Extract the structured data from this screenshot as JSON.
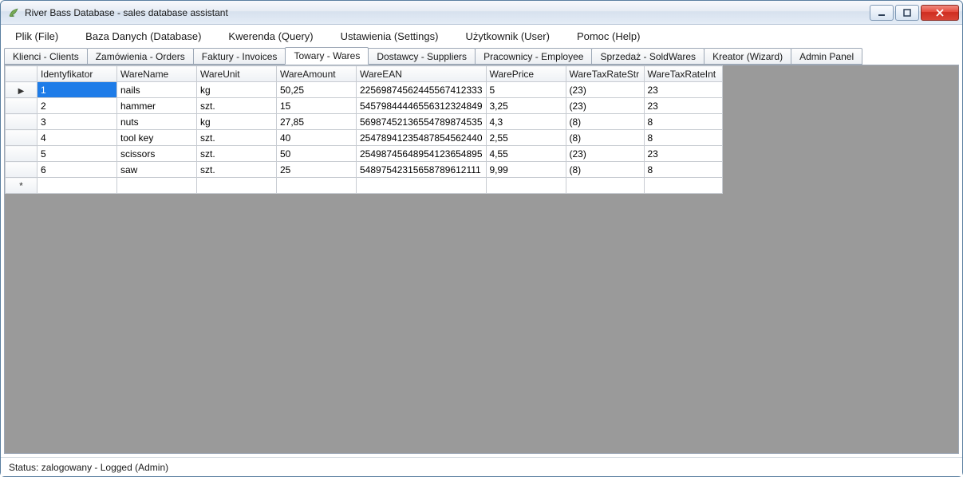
{
  "window": {
    "title": "River Bass Database - sales database assistant"
  },
  "menu": {
    "items": [
      "Plik (File)",
      "Baza Danych (Database)",
      "Kwerenda (Query)",
      "Ustawienia (Settings)",
      "Użytkownik (User)",
      "Pomoc (Help)"
    ]
  },
  "tabs": {
    "items": [
      "Klienci - Clients",
      "Zamówienia - Orders",
      "Faktury - Invoices",
      "Towary - Wares",
      "Dostawcy - Suppliers",
      "Pracownicy - Employee",
      "Sprzedaż - SoldWares",
      "Kreator (Wizard)",
      "Admin Panel"
    ],
    "active_index": 3
  },
  "grid": {
    "columns": [
      "Identyfikator",
      "WareName",
      "WareUnit",
      "WareAmount",
      "WareEAN",
      "WarePrice",
      "WareTaxRateStr",
      "WareTaxRateInt"
    ],
    "rows": [
      {
        "Identyfikator": "1",
        "WareName": "nails",
        "WareUnit": "kg",
        "WareAmount": "50,25",
        "WareEAN": "22569874562445567412333",
        "WarePrice": "5",
        "WareTaxRateStr": "(23)",
        "WareTaxRateInt": "23"
      },
      {
        "Identyfikator": "2",
        "WareName": "hammer",
        "WareUnit": "szt.",
        "WareAmount": "15",
        "WareEAN": "54579844446556312324849",
        "WarePrice": "3,25",
        "WareTaxRateStr": "(23)",
        "WareTaxRateInt": "23"
      },
      {
        "Identyfikator": "3",
        "WareName": "nuts",
        "WareUnit": "kg",
        "WareAmount": "27,85",
        "WareEAN": "56987452136554789874535",
        "WarePrice": "4,3",
        "WareTaxRateStr": "(8)",
        "WareTaxRateInt": "8"
      },
      {
        "Identyfikator": "4",
        "WareName": "tool key",
        "WareUnit": "szt.",
        "WareAmount": "40",
        "WareEAN": "25478941235487854562440",
        "WarePrice": "2,55",
        "WareTaxRateStr": "(8)",
        "WareTaxRateInt": "8"
      },
      {
        "Identyfikator": "5",
        "WareName": "scissors",
        "WareUnit": "szt.",
        "WareAmount": "50",
        "WareEAN": "25498745648954123654895",
        "WarePrice": "4,55",
        "WareTaxRateStr": "(23)",
        "WareTaxRateInt": "23"
      },
      {
        "Identyfikator": "6",
        "WareName": "saw",
        "WareUnit": "szt.",
        "WareAmount": "25",
        "WareEAN": "54897542315658789612111",
        "WarePrice": "9,99",
        "WareTaxRateStr": "(8)",
        "WareTaxRateInt": "8"
      }
    ],
    "selected_row": 0,
    "selected_col": 0
  },
  "status": {
    "text": "Status: zalogowany - Logged (Admin)"
  }
}
